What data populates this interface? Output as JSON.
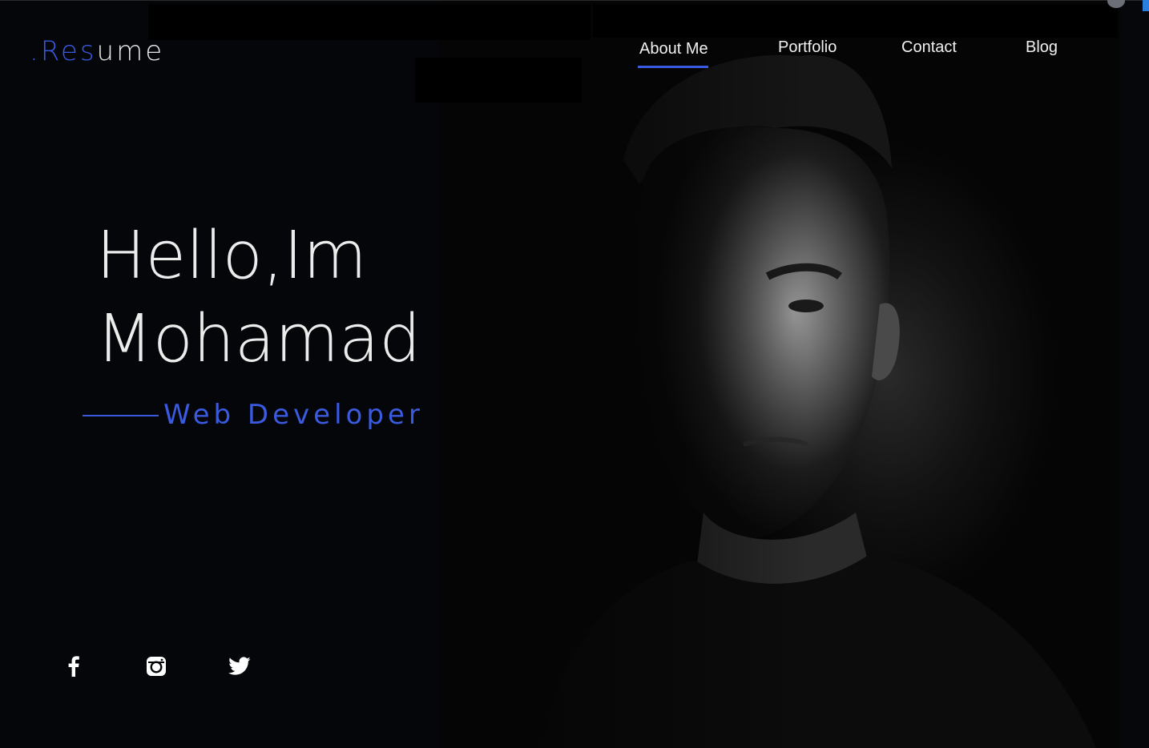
{
  "logo": {
    "prefix": ".Res",
    "suffix": "ume"
  },
  "nav": {
    "items": [
      {
        "label": "About Me",
        "active": true
      },
      {
        "label": "Portfolio",
        "active": false
      },
      {
        "label": "Contact",
        "active": false
      },
      {
        "label": "Blog",
        "active": false
      }
    ]
  },
  "hero": {
    "line1": "Hello,Im",
    "line2": "Mohamad",
    "subtitle": "Web Developer"
  },
  "social": [
    {
      "icon": "facebook-icon"
    },
    {
      "icon": "instagram-icon"
    },
    {
      "icon": "twitter-icon"
    }
  ],
  "colors": {
    "accent": "#3a5ae0",
    "background": "#04060a",
    "text": "#ececec"
  }
}
